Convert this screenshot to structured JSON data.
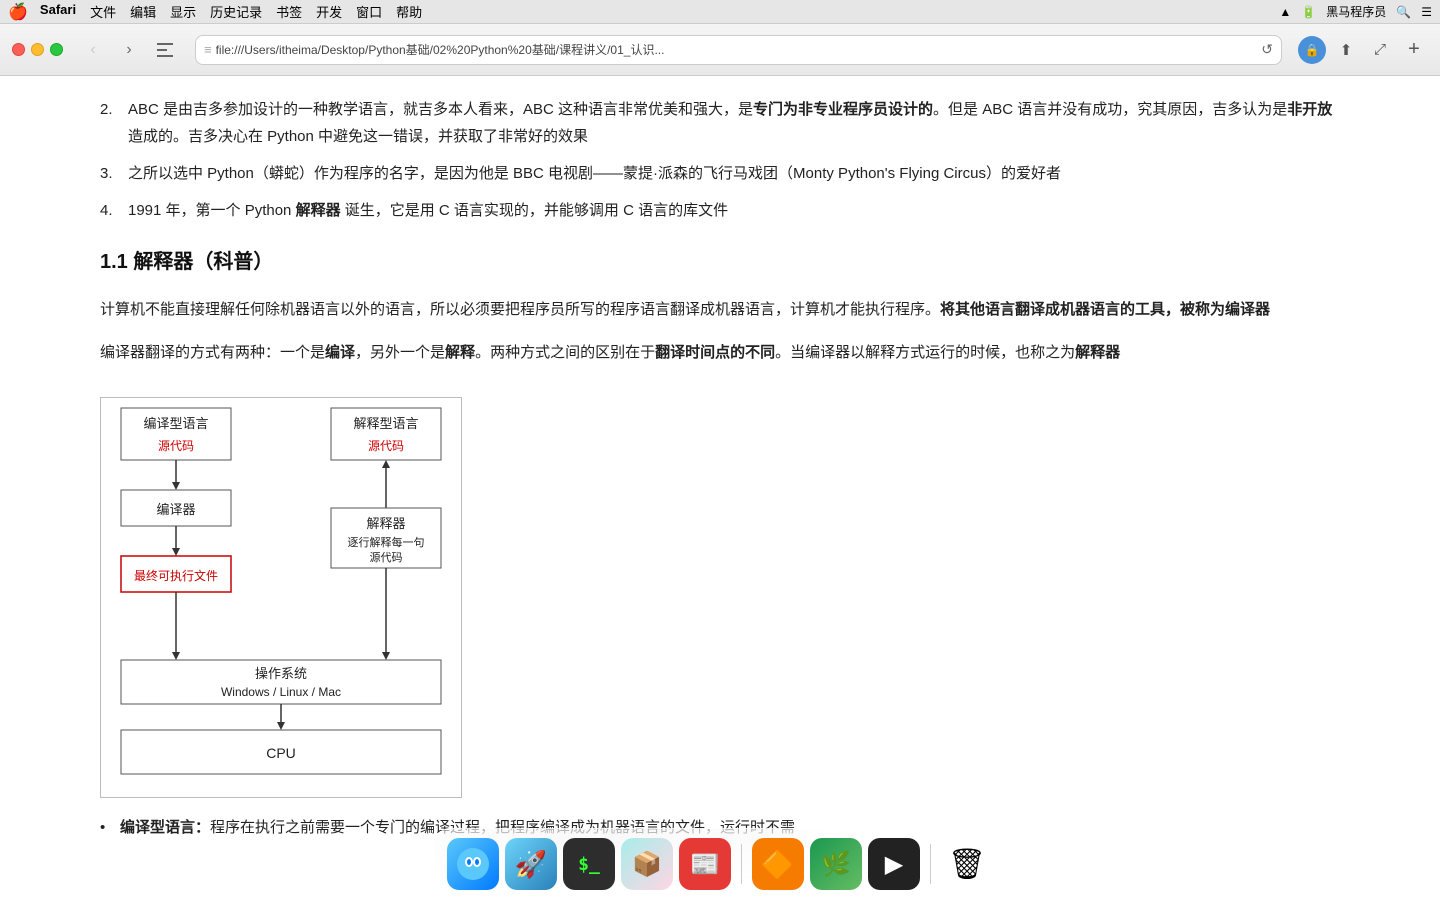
{
  "menubar": {
    "apple": "🍎",
    "items": [
      "Safari",
      "文件",
      "编辑",
      "显示",
      "历史记录",
      "书签",
      "开发",
      "窗口",
      "帮助"
    ],
    "right_items": [
      "黑马程序员"
    ]
  },
  "toolbar": {
    "address": "file:///Users/itheima/Desktop/Python基础/02%20Python%20基础/课程讲义/01_认识...",
    "back_label": "‹",
    "forward_label": "›",
    "sidebar_label": "sidebar",
    "reload_label": "↺",
    "shield_label": "🔒",
    "share_label": "⬆",
    "zoom_label": "⤢",
    "newtab_label": "+"
  },
  "content": {
    "list_items": [
      {
        "num": "2.",
        "text": "ABC 是由吉多参加设计的一种教学语言，就吉多本人看来，ABC 这种语言非常优美和强大，是",
        "bold_part": "专门为非专业程序员设计的",
        "rest": "。但是 ABC 语言并没有成功，究其原因，吉多认为是",
        "bold2": "非开放",
        "rest2": "造成的。吉多决心在 Python 中避免这一错误，并获取了非常好的效果"
      },
      {
        "num": "3.",
        "text": "之所以选中 Python（蟒蛇）作为程序的名字，是因为他是 BBC 电视剧——蒙提·派森的飞行马戏团（Monty Python's Flying Circus）的爱好者"
      },
      {
        "num": "4.",
        "text": "1991 年，第一个 Python ",
        "bold": "解释器",
        "rest": " 诞生，它是用 C 语言实现的，并能够调用 C 语言的库文件"
      }
    ],
    "section_1_1": "1.1 解释器（科普）",
    "para1": "计算机不能直接理解任何除机器语言以外的语言，所以必须要把程序员所写的程序语言翻译成机器语言，计算机才能执行程序。",
    "para1_bold": "将其他语言翻译成机器语言的工具，被称为编译器",
    "para2_pre": "编译器翻译的方式有两种：一个是",
    "para2_bold1": "编译",
    "para2_mid": "，另外一个是",
    "para2_bold2": "解释",
    "para2_rest": "。两种方式之间的区别在于",
    "para2_bold3": "翻译时间点的不同",
    "para2_end": "。当编译器以解释方式运行的时候，也称之为",
    "para2_bold4": "解释器",
    "diagram": {
      "left_top_label": "编译型语言",
      "left_top_sub": "源代码",
      "left_mid_label": "编译器",
      "left_bottom_label": "最终可执行文件",
      "right_top_label": "解释型语言",
      "right_top_sub": "源代码",
      "right_mid_label": "解释器",
      "right_mid_sub": "逐行解释每一句\n源代码",
      "bottom_os_label": "操作系统",
      "bottom_os_sub": "Windows / Linux / Mac",
      "bottom_cpu_label": "CPU"
    },
    "bullet1_pre": "编译型语言：",
    "bullet1_text": "程序在执行之前需要一个专门的编译过程，把程序编译成为机器语言的文件，运行时不需"
  },
  "dock": {
    "icons": [
      {
        "name": "finder",
        "emoji": "🖥",
        "color": "#1a73e8"
      },
      {
        "name": "launchpad",
        "emoji": "🚀",
        "color": "#f0f0f0"
      },
      {
        "name": "terminal",
        "emoji": "⬛",
        "color": "#333"
      },
      {
        "name": "caprine",
        "emoji": "📦",
        "color": "#5c6bc0"
      },
      {
        "name": "flipboard",
        "emoji": "📰",
        "color": "#e53935"
      },
      {
        "name": "vlc",
        "emoji": "🔶",
        "color": "#f57c00"
      },
      {
        "name": "sourcetree",
        "emoji": "🌿",
        "color": "#0d7a5f"
      },
      {
        "name": "mplayerx",
        "emoji": "▶",
        "color": "#333"
      },
      {
        "name": "trash",
        "emoji": "🗑",
        "color": "#aaa"
      }
    ]
  }
}
